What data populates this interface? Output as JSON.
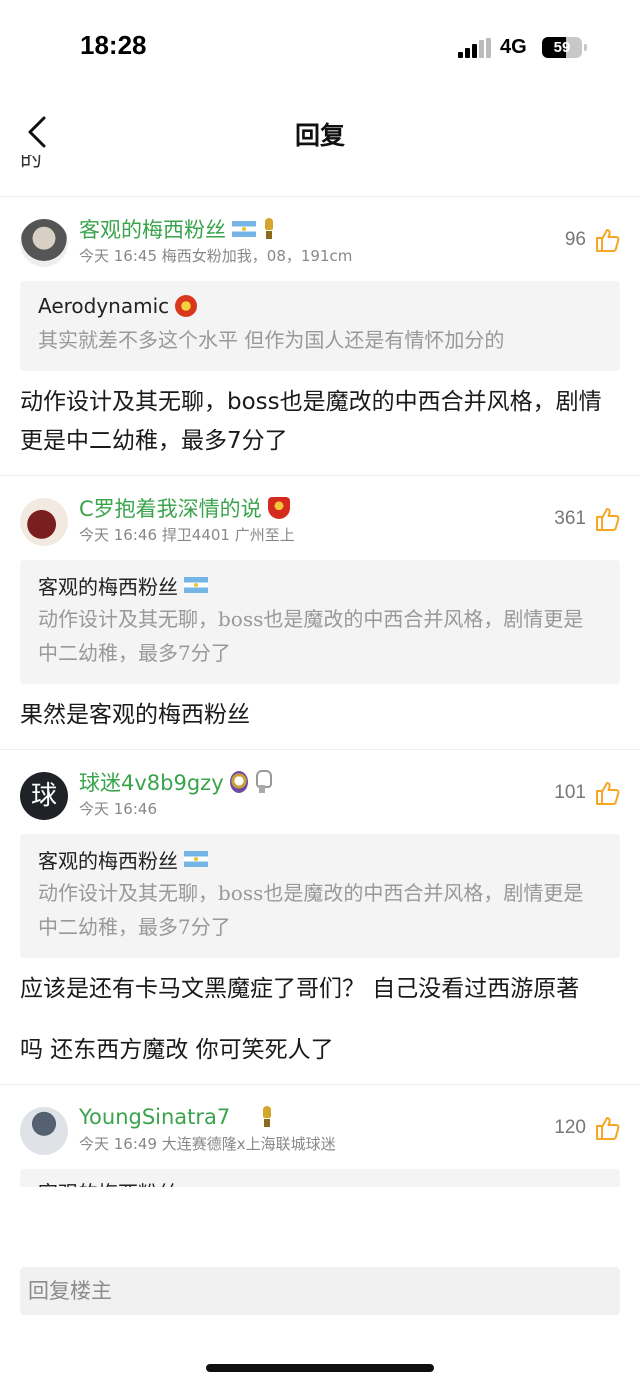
{
  "status_bar": {
    "time": "18:28",
    "network": "4G",
    "battery": "59"
  },
  "nav": {
    "title": "回复"
  },
  "partial_top_text": "的",
  "comments": [
    {
      "username": "客观的梅西粉丝",
      "time": "今天 16:45",
      "bio": "梅西女粉加我，08，191cm",
      "likes": "96",
      "quote_user": "Aerodynamic",
      "quote_text": "其实就差不多这个水平 但作为国人还是有情怀加分的",
      "body": [
        "动作设计及其无聊，boss也是魔改的中西合并风格，剧情更是中二幼稚，最多7分了"
      ]
    },
    {
      "username": "C罗抱着我深情的说",
      "time": "今天 16:46",
      "bio": "捍卫4401 广州至上",
      "likes": "361",
      "quote_user": "客观的梅西粉丝",
      "quote_text": "动作设计及其无聊，boss也是魔改的中西合并风格，剧情更是中二幼稚，最多7分了",
      "body": [
        "果然是客观的梅西粉丝"
      ]
    },
    {
      "username": "球迷4v8b9gzy",
      "avatar_text": "球",
      "time": "今天 16:46",
      "likes": "101",
      "quote_user": "客观的梅西粉丝",
      "quote_text": "动作设计及其无聊，boss也是魔改的中西合并风格，剧情更是中二幼稚，最多7分了",
      "body": [
        "应该是还有卡马文黑魔症了哥们？ 自己没看过西游原著",
        "吗 还东西方魔改 你可笑死人了"
      ]
    },
    {
      "username": "YoungSinatra7",
      "time": "今天 16:49",
      "bio": "大连赛德隆x上海联城球迷",
      "likes": "120",
      "quote_user": "客观的梅西粉丝"
    }
  ],
  "reply": {
    "placeholder": "回复楼主"
  }
}
